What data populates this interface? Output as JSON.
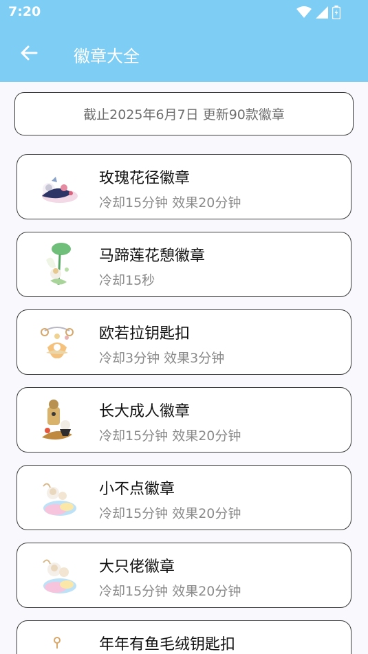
{
  "status_bar": {
    "time": "7:20"
  },
  "header": {
    "title": "徽章大全"
  },
  "notice": {
    "text": "截止2025年6月7日 更新90款徽章"
  },
  "badges": [
    {
      "name": "玫瑰花径徽章",
      "info": "冷却15分钟 效果20分钟",
      "icon": "rose-path-badge-icon"
    },
    {
      "name": "马蹄莲花憩徽章",
      "info": "冷却15秒",
      "icon": "calla-lily-badge-icon"
    },
    {
      "name": "欧若拉钥匙扣",
      "info": "冷却3分钟 效果3分钟",
      "icon": "aurora-keychain-icon"
    },
    {
      "name": "长大成人徽章",
      "info": "冷却15分钟 效果20分钟",
      "icon": "grown-up-badge-icon"
    },
    {
      "name": "小不点徽章",
      "info": "冷却15分钟 效果20分钟",
      "icon": "little-one-badge-icon"
    },
    {
      "name": "大只佬徽章",
      "info": "冷却15分钟 效果20分钟",
      "icon": "big-guy-badge-icon"
    },
    {
      "name": "年年有鱼毛绒钥匙扣",
      "info": "",
      "icon": "fish-plush-keychain-icon"
    }
  ]
}
